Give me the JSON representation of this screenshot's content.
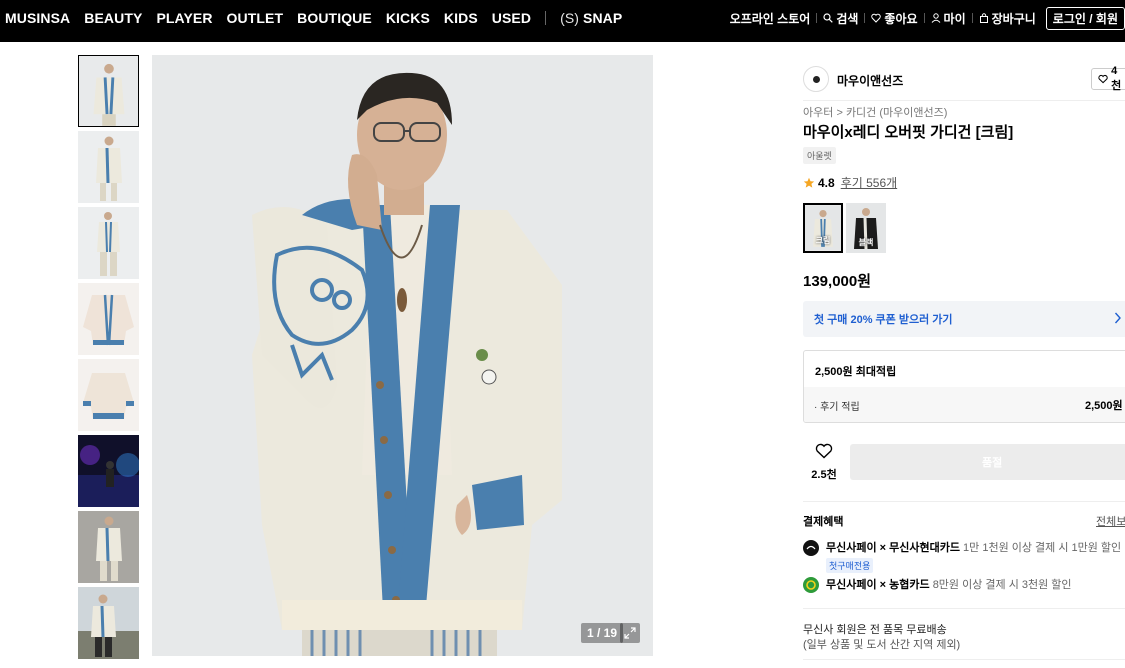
{
  "nav": {
    "brands": [
      "MUSINSA",
      "BEAUTY",
      "PLAYER",
      "OUTLET",
      "BOUTIQUE",
      "KICKS",
      "KIDS",
      "USED"
    ],
    "snap_prefix": "(S)",
    "snap_label": "SNAP",
    "offline_store": "오프라인 스토어",
    "search": "검색",
    "like": "좋아요",
    "my": "마이",
    "cart": "장바구니",
    "login": "로그인 / 회원"
  },
  "gallery": {
    "thumb_count": 8,
    "counter": "1 / 19"
  },
  "product": {
    "brand": "마우이앤선즈",
    "brand_likes": "4천",
    "breadcrumb_1": "아우터",
    "breadcrumb_sep": ">",
    "breadcrumb_2": "카디건 (마우이앤선즈)",
    "title": "마우이x레디 오버핏 가디건 [크림]",
    "tag": "아울렛",
    "rating": "4.8",
    "reviews": "후기 556개",
    "swatch_labels": [
      "크림",
      "블랙"
    ],
    "price": "139,000원",
    "coupon": "첫 구매 20% 쿠폰 받으러 가기",
    "points_title": "2,500원 최대적립",
    "points_row_label": "· 후기 적립",
    "points_row_value": "2,500원",
    "likes": "2.5천",
    "buy_label": "품절",
    "pay_heading": "결제혜택",
    "pay_all": "전체보",
    "pay1_bold": "무신사페이 × 무신사현대카드",
    "pay1_text": "1만 1천원 이상 결제 시 1만원 할인",
    "pay1_badge": "첫구매전용",
    "pay2_bold": "무신사페이 × 농협카드",
    "pay2_text": "8만원 이상 결제 시 3천원 할인",
    "ship_line1": "무신사 회원은 전 품목 무료배송",
    "ship_line2": "(일부 상품 및 도서 산간 지역 제외)"
  },
  "colors": {
    "nav_bg": "#000000",
    "coupon_text": "#1f5fd1",
    "star": "#f5a623",
    "cardigan_trim": "#4a7fae",
    "cardigan_body": "#ece9dd"
  }
}
